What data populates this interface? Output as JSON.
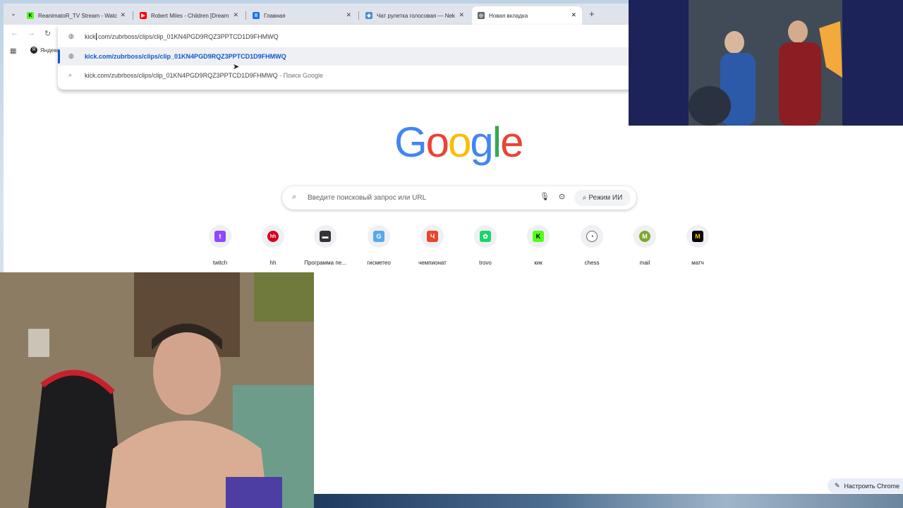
{
  "tabs": [
    {
      "title": "ReanimatoR_TV Stream - Watch",
      "favicon_color": "#53fc18",
      "favicon_glyph": "K",
      "active": false
    },
    {
      "title": "Robert Miles - Children [Dream",
      "favicon_color": "#ff0000",
      "favicon_glyph": "▶",
      "active": false
    },
    {
      "title": "Главная",
      "favicon_color": "#1a73e8",
      "favicon_glyph": "II",
      "active": false
    },
    {
      "title": "Чат рулетка голосовая — Nek",
      "favicon_color": "#4a90c8",
      "favicon_glyph": "◆",
      "active": false
    },
    {
      "title": "Новая вкладка",
      "favicon_color": "#5f6368",
      "favicon_glyph": "◎",
      "active": true
    }
  ],
  "bookmarks": {
    "item": "Яндекс"
  },
  "omnibox": {
    "typed_before_caret": "kick",
    "typed_after_caret": ".com/zubrboss/clips/clip_01KN4PGD9RQZ3PPTCD1D9FHMWQ",
    "suggestion_url": "kick.com/zubrboss/clips/clip_01KN4PGD9RQZ3PPTCD1D9FHMWQ",
    "suggestion_search_query": "kick.com/zubrboss/clips/clip_01KN4PGD9RQZ3PPTCD1D9FHMWQ",
    "suggestion_search_suffix": " - Поиск Google"
  },
  "google": {
    "logo_letters": [
      {
        "ch": "G",
        "color": "#4285f4"
      },
      {
        "ch": "o",
        "color": "#ea4335"
      },
      {
        "ch": "o",
        "color": "#fbbc05"
      },
      {
        "ch": "g",
        "color": "#4285f4"
      },
      {
        "ch": "l",
        "color": "#34a853"
      },
      {
        "ch": "e",
        "color": "#ea4335"
      }
    ],
    "search_placeholder": "Введите поисковый запрос или URL",
    "ai_mode_label": "Режим ИИ"
  },
  "shortcuts": [
    {
      "label": "twitch",
      "icon": "twitch-icon",
      "color": "#9146ff",
      "glyph": "t"
    },
    {
      "label": "hh",
      "icon": "hh-icon",
      "color": "#d6001c",
      "glyph": "hh"
    },
    {
      "label": "Программа пе...",
      "icon": "tv-program-icon",
      "color": "#333333",
      "glyph": "▬"
    },
    {
      "label": "гисметео",
      "icon": "gismeteo-icon",
      "color": "#5aa8e8",
      "glyph": "G"
    },
    {
      "label": "чемпионат",
      "icon": "championat-icon",
      "color": "#e8452c",
      "glyph": "Ч"
    },
    {
      "label": "trovo",
      "icon": "trovo-icon",
      "color": "#19d66b",
      "glyph": "✿"
    },
    {
      "label": "кик",
      "icon": "kick-icon",
      "color": "#53fc18",
      "glyph": "K"
    },
    {
      "label": "chess",
      "icon": "chess-icon",
      "color": "#6b6b6b",
      "glyph": "◔"
    },
    {
      "label": "mail",
      "icon": "mail-icon",
      "color": "#7da82c",
      "glyph": "M"
    },
    {
      "label": "матч",
      "icon": "match-icon",
      "color": "#f5c400",
      "glyph": "M"
    }
  ],
  "customize_label": "Настроить Chrome"
}
